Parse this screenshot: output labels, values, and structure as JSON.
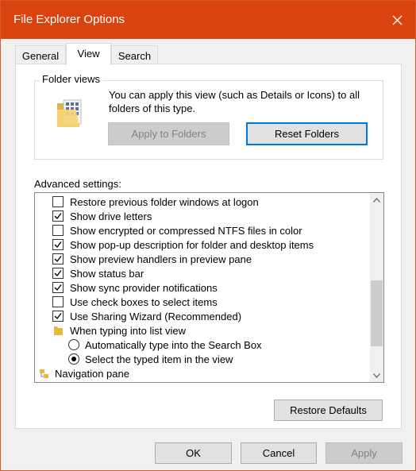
{
  "window": {
    "title": "File Explorer Options"
  },
  "tabs": [
    {
      "label": "General"
    },
    {
      "label": "View"
    },
    {
      "label": "Search"
    }
  ],
  "folder_views": {
    "label": "Folder views",
    "description": "You can apply this view (such as Details or Icons) to all folders of this type.",
    "apply_label": "Apply to Folders",
    "reset_label": "Reset Folders"
  },
  "advanced": {
    "label": "Advanced settings:",
    "items": [
      {
        "label": "Restore previous folder windows at logon",
        "type": "checkbox",
        "checked": false
      },
      {
        "label": "Show drive letters",
        "type": "checkbox",
        "checked": true
      },
      {
        "label": "Show encrypted or compressed NTFS files in color",
        "type": "checkbox",
        "checked": false
      },
      {
        "label": "Show pop-up description for folder and desktop items",
        "type": "checkbox",
        "checked": true
      },
      {
        "label": "Show preview handlers in preview pane",
        "type": "checkbox",
        "checked": true
      },
      {
        "label": "Show status bar",
        "type": "checkbox",
        "checked": true
      },
      {
        "label": "Show sync provider notifications",
        "type": "checkbox",
        "checked": true
      },
      {
        "label": "Use check boxes to select items",
        "type": "checkbox",
        "checked": false
      },
      {
        "label": "Use Sharing Wizard (Recommended)",
        "type": "checkbox",
        "checked": true
      },
      {
        "label": "When typing into list view",
        "type": "folder"
      },
      {
        "label": "Automatically type into the Search Box",
        "type": "radio",
        "checked": false
      },
      {
        "label": "Select the typed item in the view",
        "type": "radio",
        "checked": true
      },
      {
        "label": "Navigation pane",
        "type": "category"
      }
    ]
  },
  "restore_defaults_label": "Restore Defaults",
  "footer": {
    "ok_label": "OK",
    "cancel_label": "Cancel",
    "apply_label": "Apply"
  },
  "colors": {
    "titlebar": "#d9430f",
    "accent": "#0078d7"
  }
}
